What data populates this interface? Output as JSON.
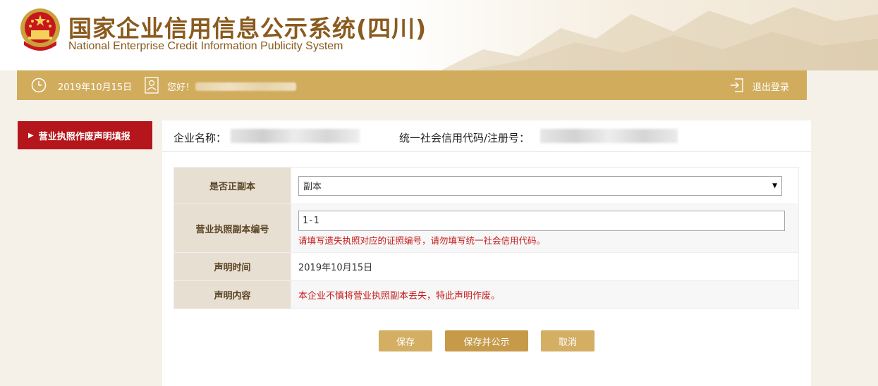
{
  "header": {
    "title_cn": "国家企业信用信息公示系统(四川)",
    "title_en": "National Enterprise Credit Information Publicity System",
    "emblem_icon": "national-emblem-icon"
  },
  "topbar": {
    "date": "2019年10月15日",
    "greeting": "您好！",
    "logout_label": "退出登录"
  },
  "sidebar": {
    "items": [
      {
        "label": "营业执照作废声明填报",
        "active": true
      }
    ]
  },
  "company": {
    "name_label": "企业名称：",
    "code_label": "统一社会信用代码/注册号："
  },
  "form": {
    "copy_type": {
      "label": "是否正副本",
      "selected": "副本"
    },
    "copy_number": {
      "label": "营业执照副本编号",
      "value": "1-1",
      "hint": "请填写遗失执照对应的证照编号，请勿填写统一社会信用代码。"
    },
    "declare_time": {
      "label": "声明时间",
      "value": "2019年10月15日"
    },
    "declare_content": {
      "label": "声明内容",
      "value": "本企业不慎将营业执照副本丢失，特此声明作废。"
    }
  },
  "buttons": {
    "save": "保存",
    "save_publish": "保存并公示",
    "cancel": "取消"
  },
  "colors": {
    "gold_bar": "#d1ac5d",
    "sidebar_active": "#b5161c",
    "label_cell": "#e8dfd3",
    "title_brown": "#8a5a1e",
    "warning_red": "#c51a1a"
  }
}
